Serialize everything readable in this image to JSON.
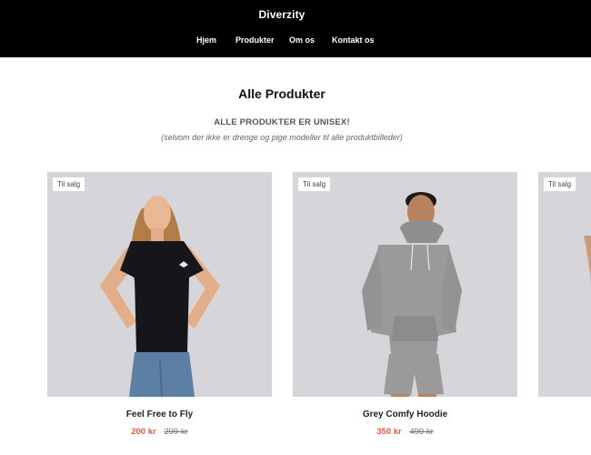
{
  "header": {
    "brand": "Diverzity",
    "nav": [
      "Hjem",
      "Produkter",
      "Om os",
      "Kontakt os"
    ]
  },
  "main": {
    "title": "Alle Produkter",
    "subheading": "ALLE PRODUKTER ER UNISEX!",
    "note": "(selvom der ikke er drenge og pige modeller til alle produktbilleder)"
  },
  "products": [
    {
      "badge": "Til salg",
      "name": "Feel Free to Fly",
      "price": "200 kr",
      "old_price": "299 kr"
    },
    {
      "badge": "Til salg",
      "name": "Grey Comfy Hoodie",
      "price": "350 kr",
      "old_price": "499 kr"
    },
    {
      "badge": "Til salg"
    }
  ],
  "colors": {
    "header_bg": "#000000",
    "sale_price": "#e05a47",
    "image_bg": "#d6d5d9"
  }
}
